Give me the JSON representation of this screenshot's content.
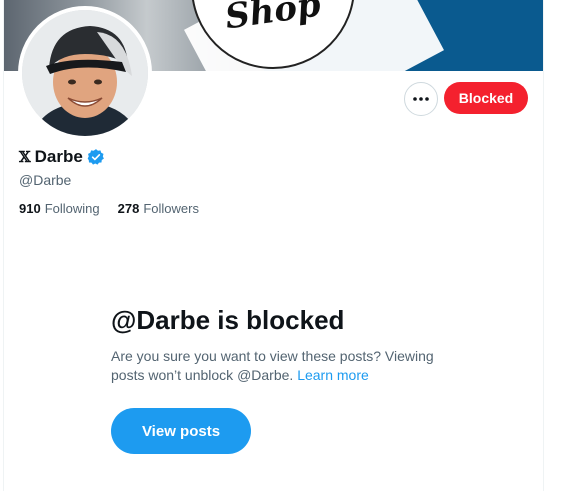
{
  "banner": {
    "logo_text": "Shop"
  },
  "actions": {
    "more_label": "More",
    "blocked_label": "Blocked"
  },
  "profile": {
    "x_glyph": "𝕏",
    "display_name": "Darbe",
    "handle": "@Darbe",
    "following_count": "910",
    "following_label": "Following",
    "followers_count": "278",
    "followers_label": "Followers",
    "verified_icon": "verified-badge-icon"
  },
  "blocked_notice": {
    "title": "@Darbe is blocked",
    "description": "Are you sure you want to view these posts? Viewing posts won’t unblock @Darbe.",
    "learn_more": "Learn more",
    "view_posts_button": "View posts"
  },
  "colors": {
    "blocked": "#f4212e",
    "accent": "#1d9bf0",
    "secondary_text": "#536471"
  }
}
